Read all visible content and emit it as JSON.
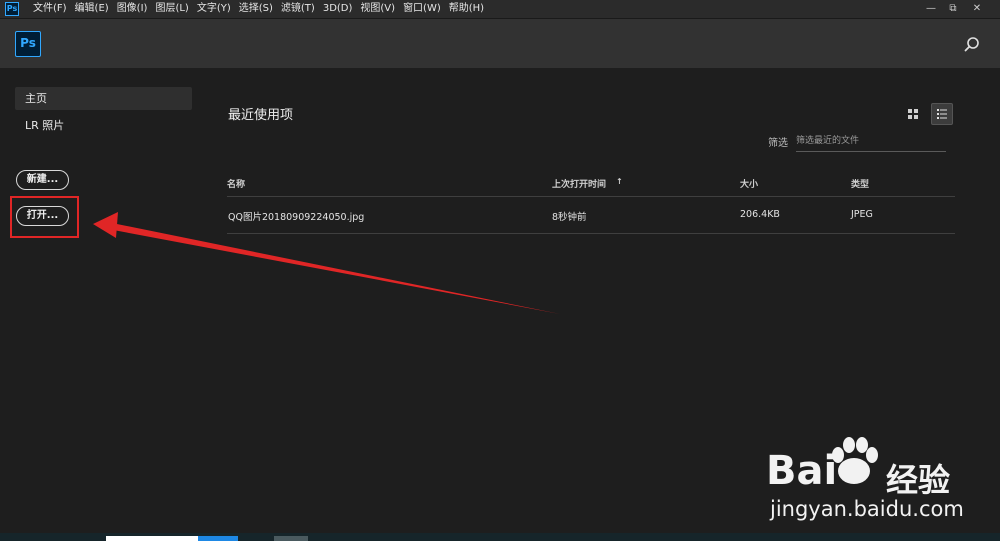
{
  "menubar": {
    "app_icon_text": "Ps",
    "items": [
      "文件(F)",
      "编辑(E)",
      "图像(I)",
      "图层(L)",
      "文字(Y)",
      "选择(S)",
      "滤镜(T)",
      "3D(D)",
      "视图(V)",
      "窗口(W)",
      "帮助(H)"
    ],
    "minimize": "—",
    "restore": "⧉",
    "close": "✕"
  },
  "header": {
    "logo_text": "Ps"
  },
  "sidebar": {
    "items": [
      {
        "label": "主页",
        "active": true
      },
      {
        "label": "LR 照片",
        "active": false
      }
    ],
    "new_button": "新建...",
    "open_button": "打开..."
  },
  "main": {
    "title": "最近使用项",
    "filter_label": "筛选",
    "filter_placeholder": "筛选最近的文件",
    "columns": {
      "name": "名称",
      "last_opened": "上次打开时间",
      "size": "大小",
      "type": "类型"
    },
    "sort_icon": "↑",
    "files": [
      {
        "name": "QQ图片20180909224050.jpg",
        "last_opened": "8秒钟前",
        "size": "206.4KB",
        "type": "JPEG"
      }
    ]
  },
  "watermark": {
    "brand_left": "Bai",
    "brand_right": "经验",
    "url": "jingyan.baidu.com"
  },
  "colors": {
    "accent": "#31a8ff",
    "annotation_red": "#e02626"
  }
}
